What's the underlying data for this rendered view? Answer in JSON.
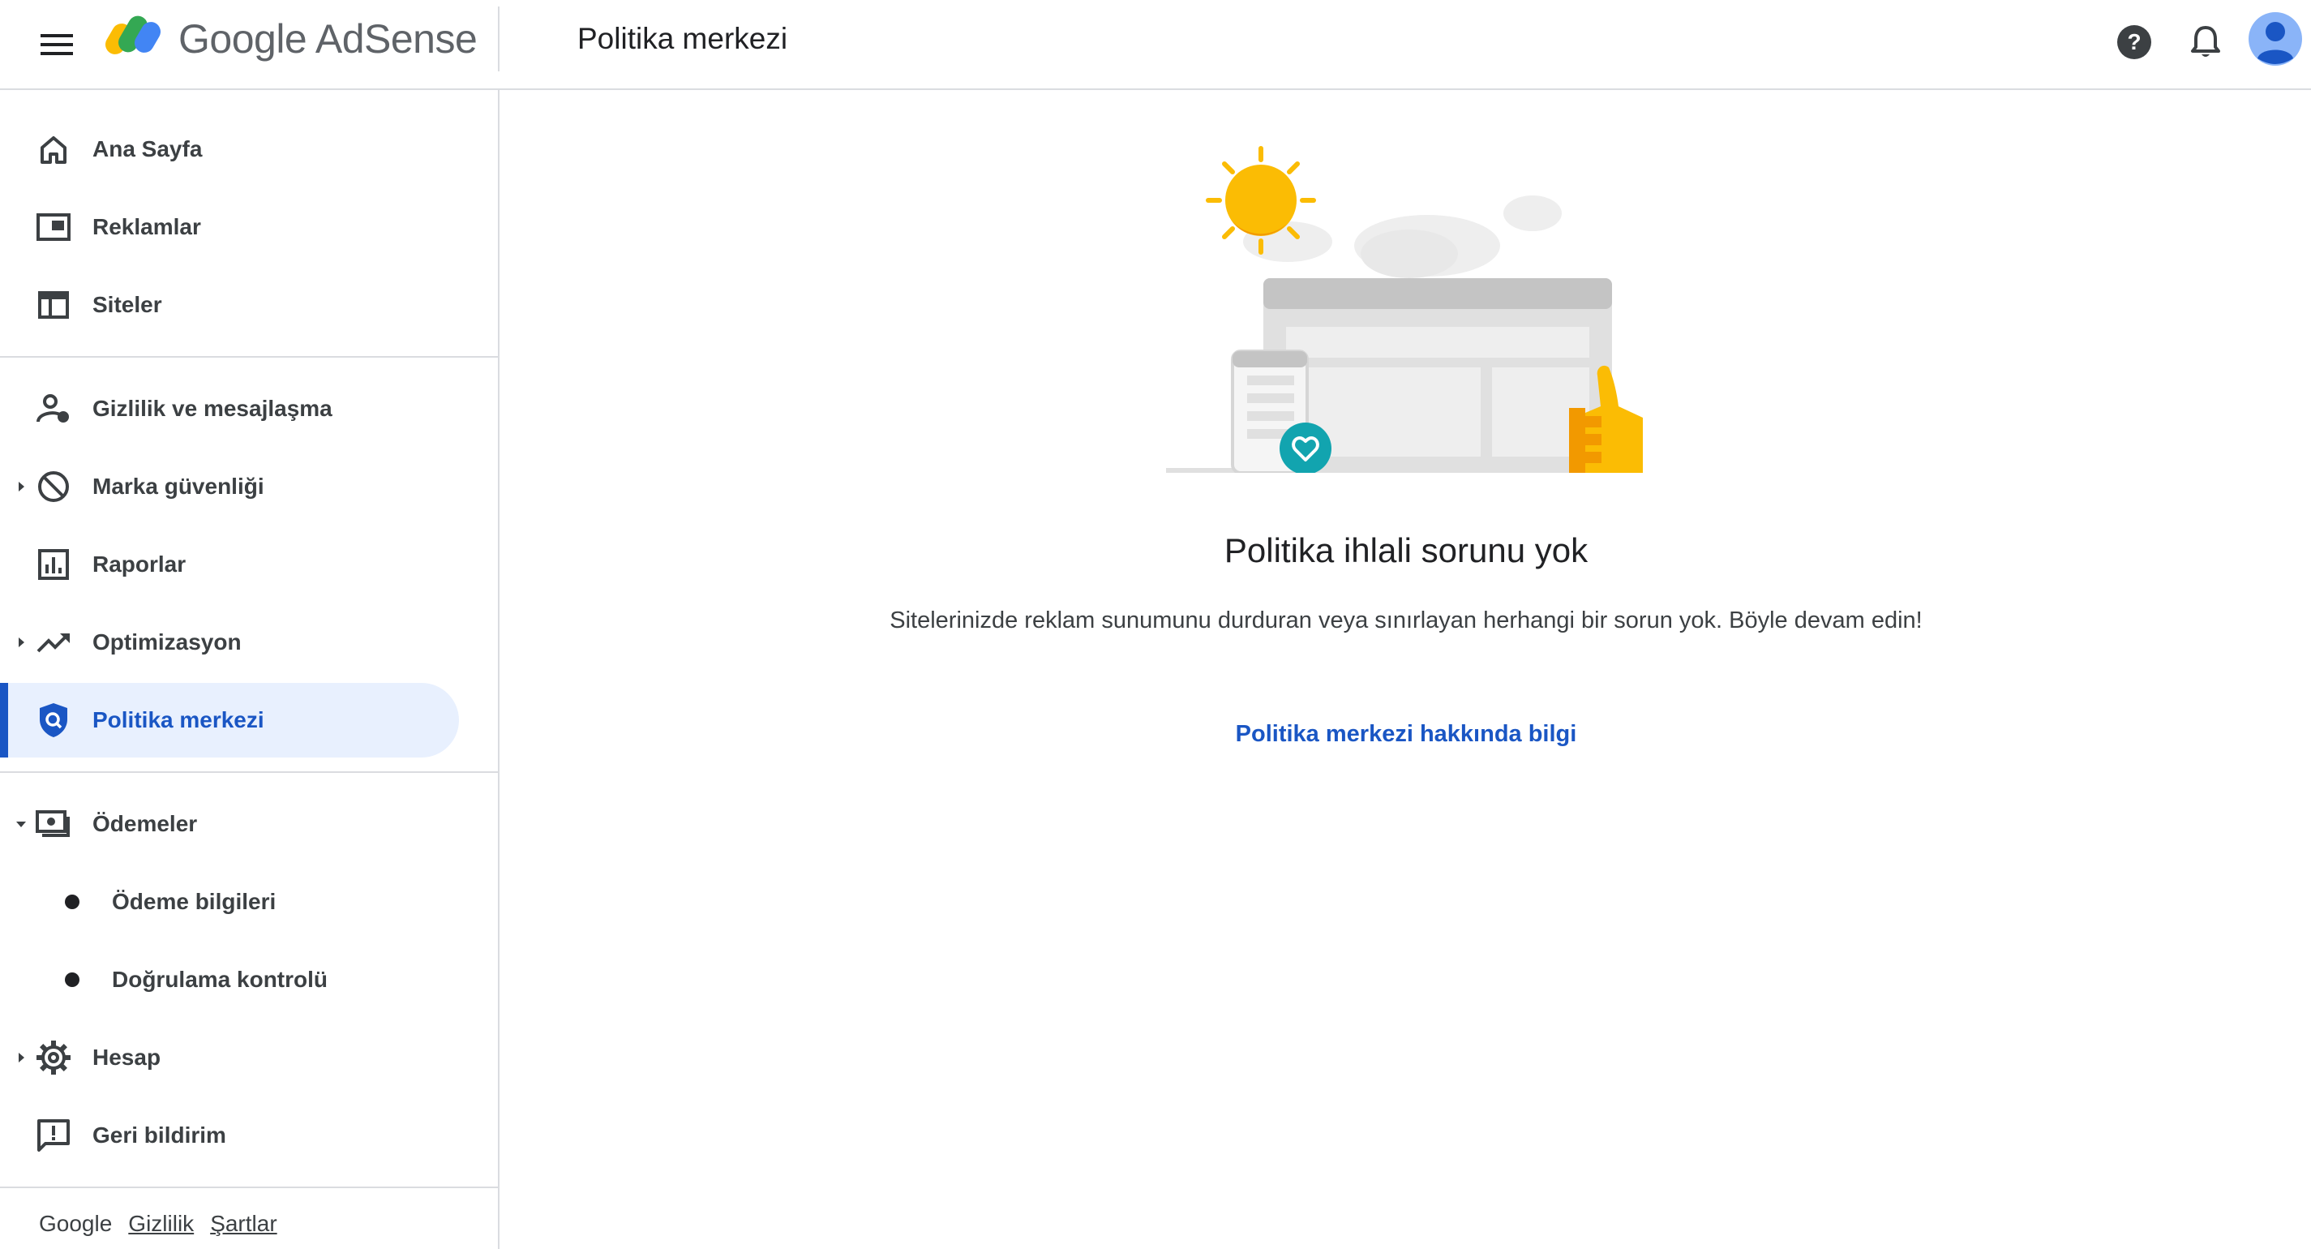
{
  "header": {
    "product_name": "Google AdSense",
    "page_title": "Politika merkezi",
    "icons": {
      "menu": "hamburger-menu-icon",
      "logo": "adsense-logo-icon",
      "help": "help-icon",
      "notifications": "bell-icon",
      "account": "avatar-icon"
    }
  },
  "sidebar": {
    "items": [
      {
        "label": "Ana Sayfa",
        "icon": "home-icon"
      },
      {
        "label": "Reklamlar",
        "icon": "ads-icon"
      },
      {
        "label": "Siteler",
        "icon": "sites-icon"
      },
      {
        "label": "Gizlilik ve mesajlaşma",
        "icon": "privacy-messaging-icon"
      },
      {
        "label": "Marka güvenliği",
        "icon": "block-icon",
        "expandable": true
      },
      {
        "label": "Raporlar",
        "icon": "reports-icon"
      },
      {
        "label": "Optimizasyon",
        "icon": "trending-up-icon",
        "expandable": true
      },
      {
        "label": "Politika merkezi",
        "icon": "policy-shield-icon",
        "active": true
      },
      {
        "label": "Ödemeler",
        "icon": "payments-icon",
        "expanded": true
      },
      {
        "label": "Ödeme bilgileri",
        "sub": true
      },
      {
        "label": "Doğrulama kontrolü",
        "sub": true
      },
      {
        "label": "Hesap",
        "icon": "gear-icon",
        "expandable": true
      },
      {
        "label": "Geri bildirim",
        "icon": "feedback-icon"
      }
    ],
    "footer": {
      "brand": "Google",
      "privacy": "Gizlilik",
      "terms": "Şartlar"
    }
  },
  "main": {
    "empty_state": {
      "title": "Politika ihlali sorunu yok",
      "description": "Sitelerinizde reklam sunumunu durduran veya sınırlayan herhangi bir sorun yok. Böyle devam edin!",
      "link": "Politika merkezi hakkında bilgi"
    }
  },
  "colors": {
    "accent": "#1a56c4",
    "active_bg": "#e8f0fe",
    "divider": "#dadce0",
    "sun": "#fbbc04",
    "teal_badge": "#12a4af"
  }
}
